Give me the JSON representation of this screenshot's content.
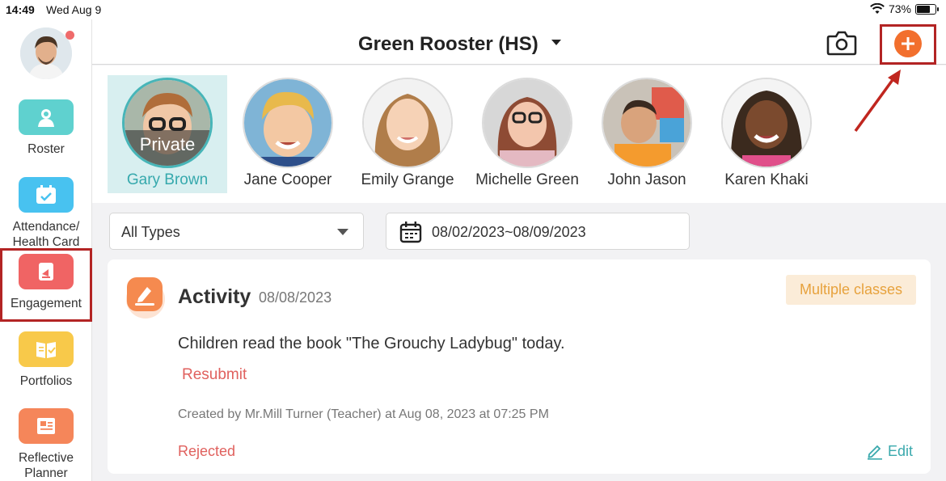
{
  "status_bar": {
    "time": "14:49",
    "date": "Wed Aug 9",
    "battery": "73%",
    "battery_level": 0.73
  },
  "sidebar": {
    "items": [
      {
        "label": "Roster",
        "icon": "roster-icon",
        "color": "#5fd1cf"
      },
      {
        "label": "Attendance/\nHealth Card",
        "icon": "calendar-check-icon",
        "color": "#48c2f0"
      },
      {
        "label": "Engagement",
        "icon": "engagement-icon",
        "color": "#f06464",
        "active": true
      },
      {
        "label": "Portfolios",
        "icon": "portfolio-icon",
        "color": "#f8c94a"
      },
      {
        "label": "Reflective\nPlanner",
        "icon": "planner-icon",
        "color": "#f5865a"
      }
    ]
  },
  "header": {
    "class_name": "Green Rooster (HS)"
  },
  "children": [
    {
      "name": "Gary Brown",
      "overlay": "Private",
      "selected": true
    },
    {
      "name": "Jane Cooper"
    },
    {
      "name": "Emily Grange"
    },
    {
      "name": "Michelle Green"
    },
    {
      "name": "John Jason"
    },
    {
      "name": "Karen Khaki"
    }
  ],
  "filters": {
    "type": "All Types",
    "date_range": "08/02/2023~08/09/2023"
  },
  "card": {
    "type": "Activity",
    "date": "08/08/2023",
    "badge": "Multiple classes",
    "text": "Children read the book \"The Grouchy Ladybug\" today.",
    "action": "Resubmit",
    "created": "Created by Mr.Mill Turner (Teacher) at Aug 08, 2023 at 07:25 PM",
    "status": "Rejected",
    "edit_label": "Edit"
  },
  "colors": {
    "accent": "#3aa9ad",
    "add": "#f26f2d",
    "highlight": "#b32424",
    "reject": "#e0615e"
  }
}
